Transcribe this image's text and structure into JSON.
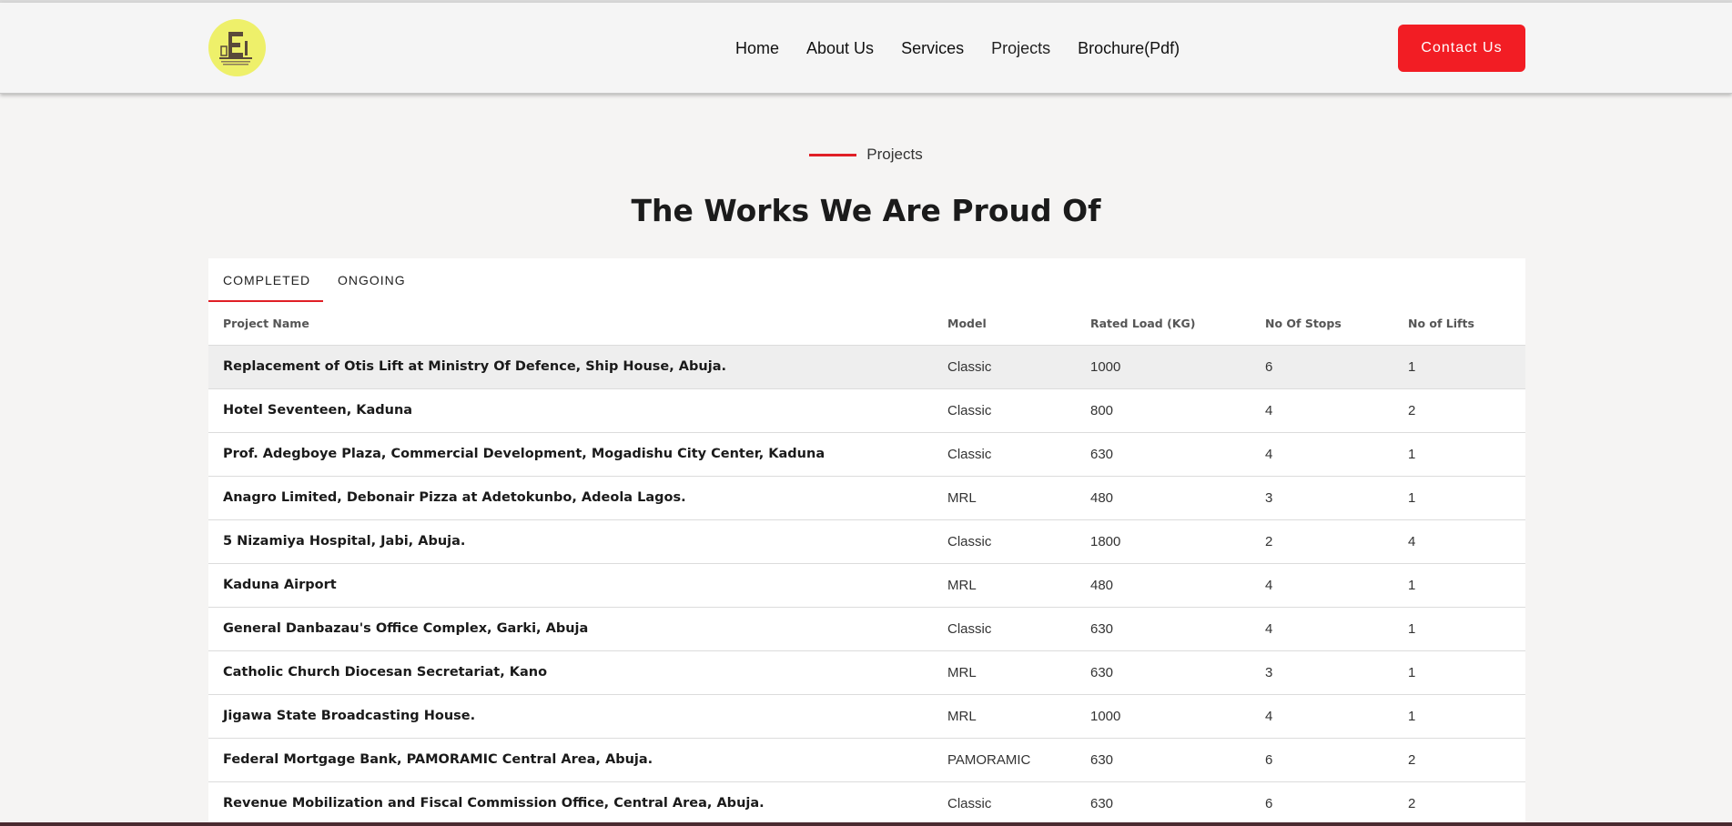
{
  "header": {
    "logo_alt": "E",
    "nav": [
      "Home",
      "About Us",
      "Services",
      "Projects",
      "Brochure(Pdf)"
    ],
    "contact_label": "Contact Us"
  },
  "section": {
    "eyebrow": "Projects",
    "title": "The Works We Are Proud Of"
  },
  "tabs": [
    "COMPLETED",
    "ONGOING"
  ],
  "table": {
    "columns": [
      "Project Name",
      "Model",
      "Rated Load (KG)",
      "No Of Stops",
      "No of Lifts"
    ],
    "rows": [
      [
        "Replacement of Otis Lift at Ministry Of Defence, Ship House, Abuja.",
        "Classic",
        "1000",
        "6",
        "1"
      ],
      [
        "Hotel Seventeen, Kaduna",
        "Classic",
        "800",
        "4",
        "2"
      ],
      [
        "Prof. Adegboye Plaza, Commercial Development, Mogadishu City Center, Kaduna",
        "Classic",
        "630",
        "4",
        "1"
      ],
      [
        "Anagro Limited, Debonair Pizza at Adetokunbo, Adeola Lagos.",
        "MRL",
        "480",
        "3",
        "1"
      ],
      [
        "5 Nizamiya Hospital, Jabi, Abuja.",
        "Classic",
        "1800",
        "2",
        "4"
      ],
      [
        "Kaduna Airport",
        "MRL",
        "480",
        "4",
        "1"
      ],
      [
        "General Danbazau's Office Complex, Garki, Abuja",
        "Classic",
        "630",
        "4",
        "1"
      ],
      [
        "Catholic Church Diocesan Secretariat, Kano",
        "MRL",
        "630",
        "3",
        "1"
      ],
      [
        "Jigawa State Broadcasting House.",
        "MRL",
        "1000",
        "4",
        "1"
      ],
      [
        "Federal Mortgage Bank, PAMORAMIC Central Area, Abuja.",
        "PAMORAMIC",
        "630",
        "6",
        "2"
      ],
      [
        "Revenue Mobilization and Fiscal Commission Office, Central Area, Abuja.",
        "Classic",
        "630",
        "6",
        "2"
      ]
    ]
  },
  "colors": {
    "accent": "#f21d24",
    "logo_bg": "#eef06a"
  }
}
